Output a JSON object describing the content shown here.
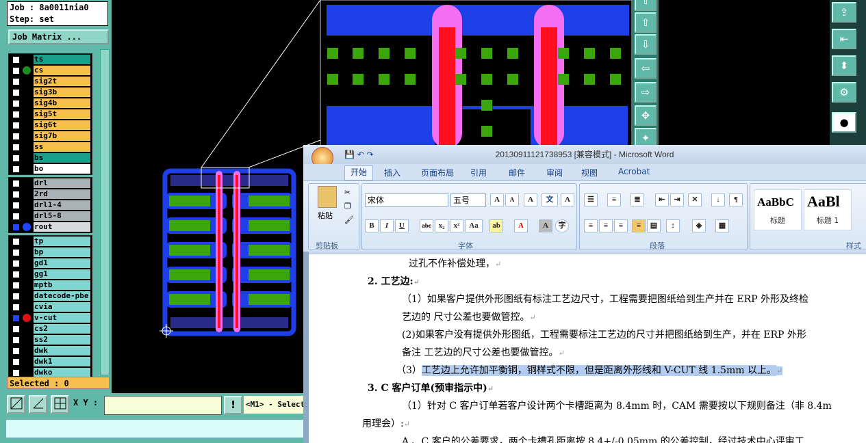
{
  "cam": {
    "job_label": "Job : 8a0011nia0",
    "step_label": "Step: set",
    "job_matrix_button": "Job Matrix ...",
    "layers_group1": [
      {
        "name": "ts",
        "color": "#1a9e8a",
        "dot": ""
      },
      {
        "name": "cs",
        "color": "#f5c050",
        "dot": "#1f8c1f"
      },
      {
        "name": "sig2t",
        "color": "#f5c050",
        "dot": ""
      },
      {
        "name": "sig3b",
        "color": "#f5c050",
        "dot": ""
      },
      {
        "name": "sig4b",
        "color": "#f5c050",
        "dot": ""
      },
      {
        "name": "sig5t",
        "color": "#f5c050",
        "dot": ""
      },
      {
        "name": "sig6t",
        "color": "#f5c050",
        "dot": ""
      },
      {
        "name": "sig7b",
        "color": "#f5c050",
        "dot": ""
      },
      {
        "name": "ss",
        "color": "#f5c050",
        "dot": ""
      },
      {
        "name": "bs",
        "color": "#1a9e8a",
        "dot": ""
      },
      {
        "name": "bo",
        "color": "#ffffff",
        "dot": ""
      }
    ],
    "layers_group2": [
      {
        "name": "drl",
        "color": "#a9b3b7",
        "dot": ""
      },
      {
        "name": "2rd",
        "color": "#a9b3b7",
        "dot": ""
      },
      {
        "name": "drl1-4",
        "color": "#a9b3b7",
        "dot": ""
      },
      {
        "name": "drl5-8",
        "color": "#a9b3b7",
        "dot": ""
      },
      {
        "name": "rout",
        "color": "#d6dadc",
        "dot": "#2244ff",
        "checked": true
      }
    ],
    "layers_group3": [
      {
        "name": "tp",
        "color": "#7fd6d0",
        "dot": ""
      },
      {
        "name": "bp",
        "color": "#7fd6d0",
        "dot": ""
      },
      {
        "name": "gd1",
        "color": "#7fd6d0",
        "dot": ""
      },
      {
        "name": "gg1",
        "color": "#7fd6d0",
        "dot": ""
      },
      {
        "name": "mptb",
        "color": "#7fd6d0",
        "dot": ""
      },
      {
        "name": "datecode-pbe",
        "color": "#7fd6d0",
        "dot": ""
      },
      {
        "name": "cvia",
        "color": "#7fd6d0",
        "dot": ""
      },
      {
        "name": "v-cut",
        "color": "#7fd6d0",
        "dot": "#dd1111",
        "checked": true
      },
      {
        "name": "cs2",
        "color": "#7fd6d0",
        "dot": ""
      },
      {
        "name": "ss2",
        "color": "#7fd6d0",
        "dot": ""
      },
      {
        "name": "dwk",
        "color": "#7fd6d0",
        "dot": ""
      },
      {
        "name": "dwk1",
        "color": "#7fd6d0",
        "dot": ""
      },
      {
        "name": "dwko",
        "color": "#7fd6d0",
        "dot": ""
      }
    ],
    "selected_label": "Selected : 0",
    "xy_label": "X Y :",
    "message": "<M1> - Select"
  },
  "word": {
    "title": "20130911121738953 [兼容模式] - Microsoft Word",
    "tabs": [
      "开始",
      "插入",
      "页面布局",
      "引用",
      "邮件",
      "审阅",
      "视图",
      "Acrobat"
    ],
    "font_name": "宋体",
    "font_size": "五号",
    "paste_label": "粘贴",
    "groups": {
      "clipboard": "剪贴板",
      "font": "字体",
      "paragraph": "段落",
      "styles": "样式"
    },
    "styles": [
      {
        "preview": "AaBbC",
        "name": "标题"
      },
      {
        "preview": "AaBl",
        "name": "标题 1"
      }
    ],
    "doc_lines": [
      "过孔不作补偿处理，",
      "2.  工艺边:",
      "（1）如果客户提供外形图纸有标注工艺边尺寸，工程需要把图纸给到生产并在 ERP 外形及终检",
      "艺边的 尺寸公差也要做管控。",
      "(2)如果客户没有提供外形图纸，工程需要标注工艺边的尺寸并把图纸给到生产，并在 ERP 外形",
      "备注   工艺边的尺寸公差也要做管控。",
      "（3）",
      "工艺边上允许加平衡铜，铜样式不限，但是距离外形线和 V-CUT 线 1.5mm 以上。",
      "3.  C 客户订单(预审指示中)",
      "（1）针对 C 客户订单若客户设计两个卡槽距离为 8.4mm 时，CAM 需要按以下规则备注（非 8.4m",
      "用理会）:",
      "A 、C 客户的公差要求，两个卡槽孔距离按 8.4+/-0.05mm 的公差控制，经过技术中心评审工"
    ]
  }
}
